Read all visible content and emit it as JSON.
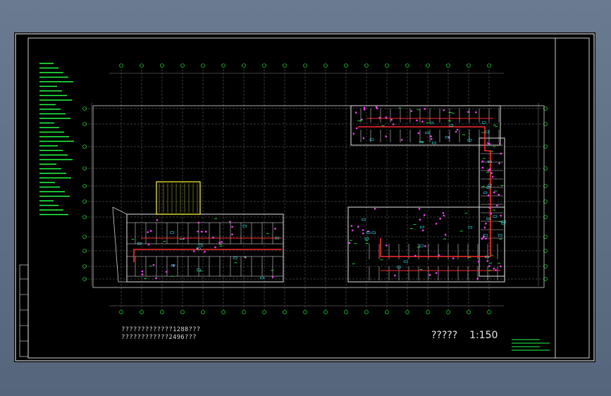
{
  "drawing": {
    "notes": [
      "?????????????1288???",
      "????????????2496???"
    ],
    "scale_title": "?????",
    "scale_value": "1:150"
  },
  "colors": {
    "background": "#000000",
    "frame": "#ffffff",
    "grid": "#8a8a8a",
    "wall": "#d0d0d0",
    "annotation": "#22ff44",
    "pipe": "#ff2a2a",
    "equipment": "#ff40ff",
    "stair": "#ffff33",
    "tag": "#33ffff"
  }
}
